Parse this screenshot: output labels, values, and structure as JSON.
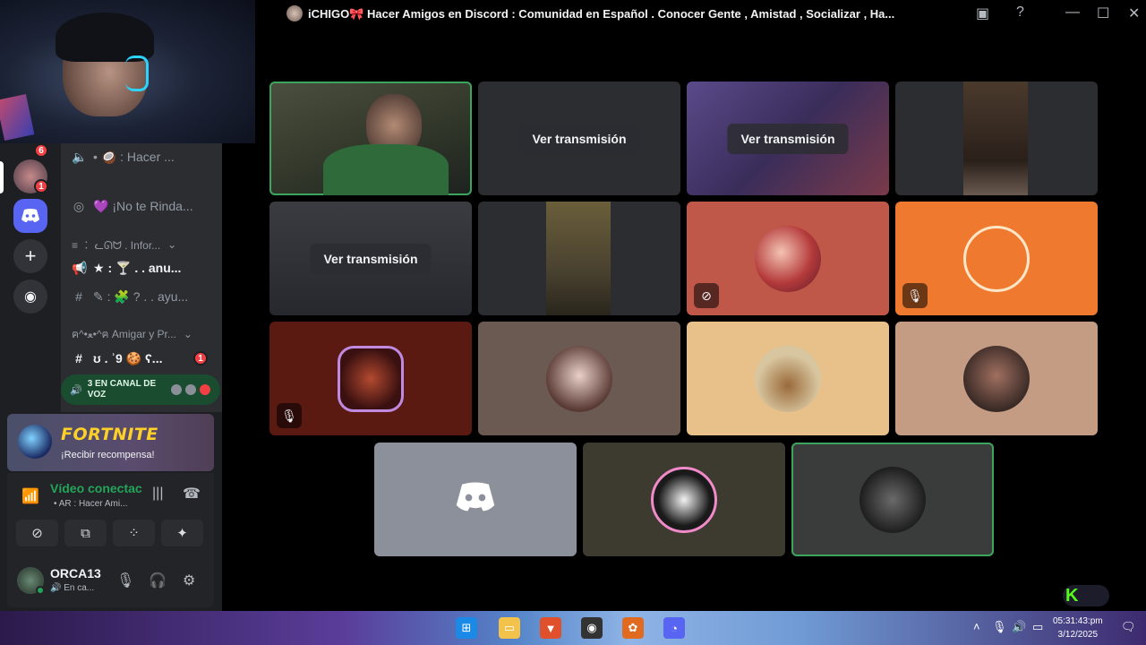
{
  "window": {
    "title": "iCHIGO🎀 Hacer Amigos en Discord : Comunidad en Español . Conocer Gente , Amistad , Socializar , Ha..."
  },
  "sidebar": {
    "servers": [
      {
        "badge": "6"
      },
      {
        "badge": "1"
      }
    ],
    "channels": [
      {
        "icon": "speaker-icon",
        "label": "• 🥥 : Hacer ..."
      },
      {
        "icon": "stage-icon",
        "label": "💜 ¡No te Rinda..."
      },
      {
        "icon": "category",
        "label": "≡ ︰ ᓚᘏᗢ . Infor..."
      },
      {
        "icon": "announce-icon",
        "label": "★ : 🍸 . . anu..."
      },
      {
        "icon": "hash-icon",
        "label": "✎ : 🧩 ? . . ayu..."
      },
      {
        "icon": "category",
        "label": "ฅ^•ﻌ•^ฅ Amigar y Pr..."
      },
      {
        "icon": "hash-icon",
        "label": "ʊ . ʾ9 🍪 ʕ...",
        "badge": "1"
      }
    ],
    "voice_pill": {
      "label": "3 EN CANAL DE VOZ"
    }
  },
  "promo": {
    "title": "FORTNITE",
    "subtitle": "¡Recibir recompensa!"
  },
  "voice_connection": {
    "status": "Vídeo conectac",
    "channel": "• AR : Hacer Ami..."
  },
  "user": {
    "name": "ORCA13",
    "status": "🔊 En ca..."
  },
  "stage": {
    "watch_label": "Ver transmisión",
    "tiles": [
      {
        "type": "camera",
        "speaking": true
      },
      {
        "type": "stream",
        "label": "Ver transmisión"
      },
      {
        "type": "stream",
        "label": "Ver transmisión"
      },
      {
        "type": "camera"
      },
      {
        "type": "stream",
        "label": "Ver transmisión"
      },
      {
        "type": "camera"
      },
      {
        "type": "avatar",
        "bg": "#c05849",
        "muted": "camera-off"
      },
      {
        "type": "avatar",
        "bg": "#ef7a2f",
        "muted": "mic-off"
      },
      {
        "type": "avatar",
        "bg": "#5a1a12",
        "muted": "mic-off"
      },
      {
        "type": "avatar",
        "bg": "#6b5a52"
      },
      {
        "type": "avatar",
        "bg": "#e7c08a"
      },
      {
        "type": "avatar",
        "bg": "#c49b83"
      },
      {
        "type": "discord",
        "bg": "#8c909a"
      },
      {
        "type": "avatar",
        "bg": "#3d3a30"
      },
      {
        "type": "avatar",
        "bg": "#3a3c3c",
        "speaking": true
      }
    ]
  },
  "taskbar": {
    "time": "05:31:43:pm",
    "date": "3/12/2025"
  },
  "colors": {
    "accent_green": "#3ba55d",
    "discord_blurple": "#5865f2",
    "danger": "#f23f43"
  }
}
